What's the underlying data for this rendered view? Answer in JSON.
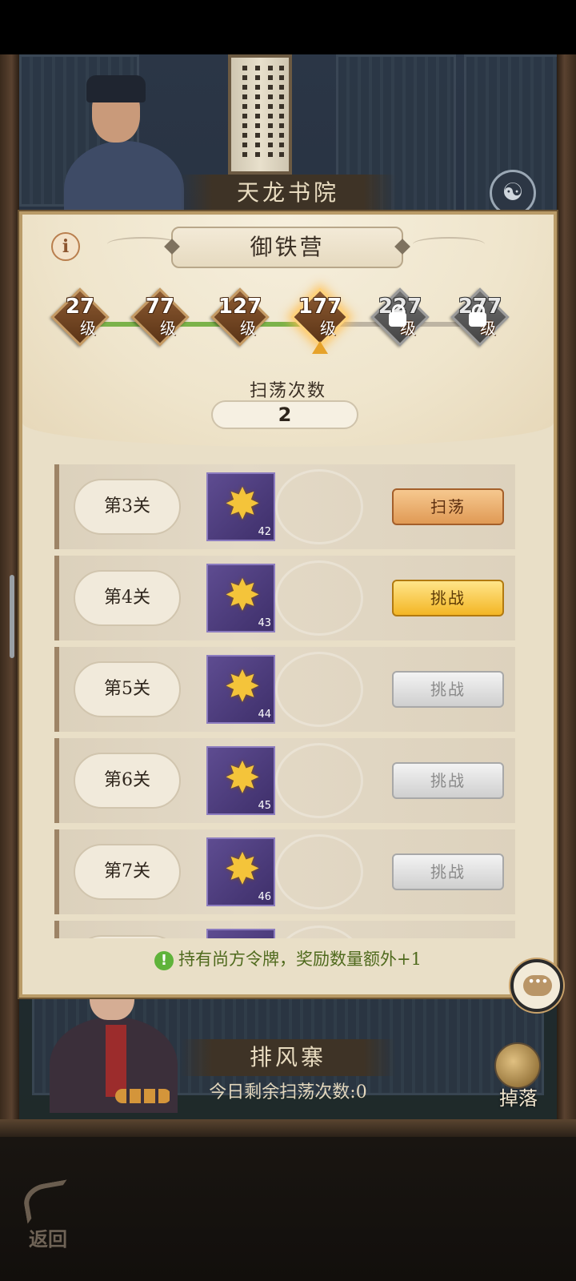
{
  "location": {
    "top_banner": "天龙书院",
    "bottom_banner": "排风寨",
    "sweeps_remaining_today": "今日剩余扫荡次数:0"
  },
  "dialog": {
    "title": "御铁营",
    "info_icon": "i",
    "levels": [
      {
        "level": "27",
        "unit": "级",
        "state": "cleared"
      },
      {
        "level": "77",
        "unit": "级",
        "state": "cleared"
      },
      {
        "level": "127",
        "unit": "级",
        "state": "cleared"
      },
      {
        "level": "177",
        "unit": "级",
        "state": "current"
      },
      {
        "level": "227",
        "unit": "级",
        "state": "locked"
      },
      {
        "level": "277",
        "unit": "级",
        "state": "locked"
      }
    ],
    "sweep_label": "扫荡次数",
    "sweep_count": "2",
    "stages": [
      {
        "name": "第3关",
        "reward_qty": "42",
        "action": "扫荡",
        "action_state": "sweep"
      },
      {
        "name": "第4关",
        "reward_qty": "43",
        "action": "挑战",
        "action_state": "active"
      },
      {
        "name": "第5关",
        "reward_qty": "44",
        "action": "挑战",
        "action_state": "disabled"
      },
      {
        "name": "第6关",
        "reward_qty": "45",
        "action": "挑战",
        "action_state": "disabled"
      },
      {
        "name": "第7关",
        "reward_qty": "46",
        "action": "挑战",
        "action_state": "disabled"
      }
    ],
    "notice_icon": "!",
    "notice": "持有尚方令牌，奖励数量额外+1"
  },
  "buttons": {
    "drop": "掉落",
    "back": "返回"
  },
  "icons": {
    "info": "info-icon",
    "lock": "lock-icon",
    "reward": "gold-star-item-icon",
    "chat": "chat-bubble-icon",
    "back": "back-arrow-icon",
    "drop": "drop-item-icon",
    "yinyang": "yinyang-icon"
  },
  "colors": {
    "panel_bg": "#e9dfc7",
    "accent_gold": "#f3b625",
    "sweep_orange": "#e09a55",
    "progress_green": "#7bb24a",
    "reward_purple": "#4e3f80"
  }
}
